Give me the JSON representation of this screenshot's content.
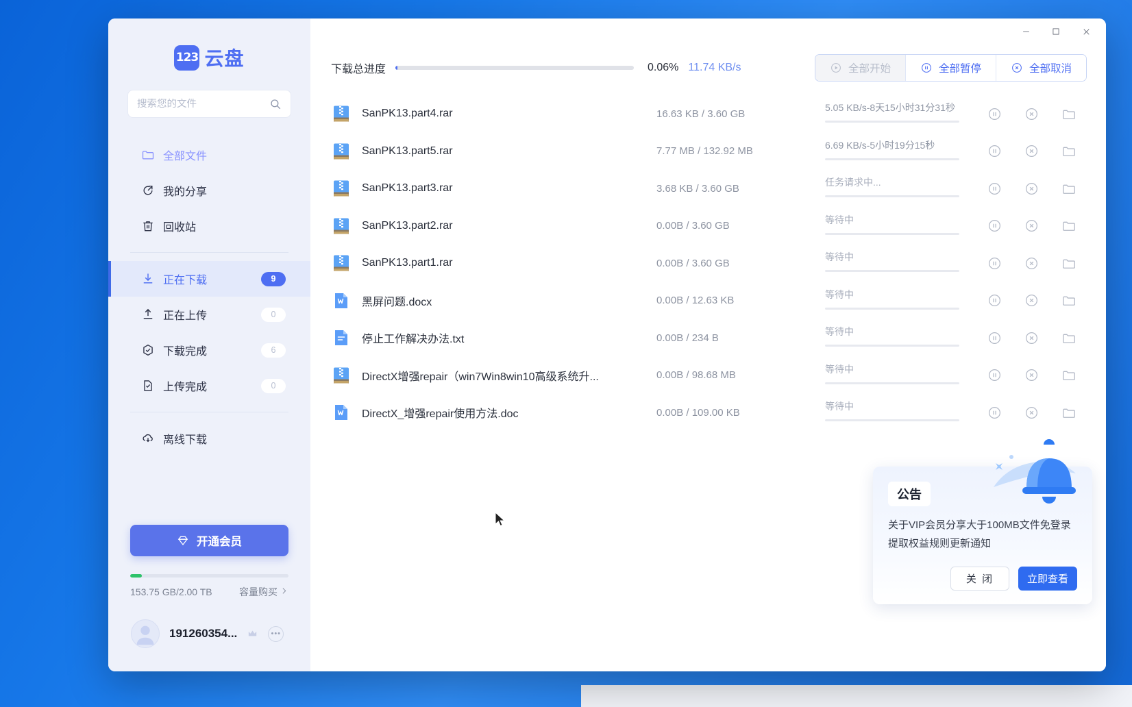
{
  "brand": {
    "logo_mark": "123",
    "logo_text": "云盘",
    "logo_icon": "cloud-disk-logo"
  },
  "search": {
    "placeholder": "搜索您的文件",
    "value": "",
    "icon": "search-icon"
  },
  "sidebar": {
    "primary_items": [
      {
        "label": "全部文件",
        "icon": "folder-icon",
        "state": "tinted"
      },
      {
        "label": "我的分享",
        "icon": "share-icon",
        "state": "normal"
      },
      {
        "label": "回收站",
        "icon": "trash-icon",
        "state": "normal"
      }
    ],
    "transfer_items": [
      {
        "label": "正在下载",
        "icon": "download-icon",
        "badge": "9",
        "state": "active"
      },
      {
        "label": "正在上传",
        "icon": "upload-icon",
        "badge": "0",
        "state": "normal"
      },
      {
        "label": "下载完成",
        "icon": "check-circle-icon",
        "badge": "6",
        "state": "normal"
      },
      {
        "label": "上传完成",
        "icon": "file-check-icon",
        "badge": "0",
        "state": "normal"
      }
    ],
    "offline_items": [
      {
        "label": "离线下载",
        "icon": "cloud-download-icon",
        "state": "normal"
      }
    ],
    "vip_button": {
      "label": "开通会员",
      "icon": "diamond-icon"
    },
    "storage": {
      "used_label": "153.75 GB/2.00 TB",
      "buy_label": "容量购买",
      "percent": 7.5,
      "fill_color": "#2ec36b"
    },
    "user": {
      "name": "191260354...",
      "avatar_icon": "user-avatar",
      "vip_icon": "vip-crown-icon",
      "more_icon": "more-horizontal-icon"
    }
  },
  "titlebar": {
    "minimize": "—",
    "maximize": "□",
    "close": "✕"
  },
  "toolbar": {
    "progress_label": "下载总进度",
    "progress_percent_value": 0.06,
    "progress_percent_text": "0.06%",
    "speed": "11.74 KB/s",
    "actions": [
      {
        "label": "全部开始",
        "icon": "play-circle-icon",
        "disabled": true
      },
      {
        "label": "全部暂停",
        "icon": "pause-circle-icon",
        "disabled": false
      },
      {
        "label": "全部取消",
        "icon": "close-circle-icon",
        "disabled": false
      }
    ]
  },
  "rows": [
    {
      "name": "SanPK13.part4.rar",
      "icon": "rar-file-icon",
      "size": "16.63 KB / 3.60 GB",
      "status": "5.05 KB/s-8天15小时31分31秒",
      "status_kind": "active",
      "progress": 0
    },
    {
      "name": "SanPK13.part5.rar",
      "icon": "rar-file-icon",
      "size": "7.77 MB / 132.92 MB",
      "status": "6.69 KB/s-5小时19分15秒",
      "status_kind": "active",
      "progress": 5.8
    },
    {
      "name": "SanPK13.part3.rar",
      "icon": "rar-file-icon",
      "size": "3.68 KB / 3.60 GB",
      "status": "任务请求中...",
      "status_kind": "pending",
      "progress": 0
    },
    {
      "name": "SanPK13.part2.rar",
      "icon": "rar-file-icon",
      "size": "0.00B / 3.60 GB",
      "status": "等待中",
      "status_kind": "waiting",
      "progress": 0
    },
    {
      "name": "SanPK13.part1.rar",
      "icon": "rar-file-icon",
      "size": "0.00B / 3.60 GB",
      "status": "等待中",
      "status_kind": "waiting",
      "progress": 0
    },
    {
      "name": "黑屏问题.docx",
      "icon": "word-file-icon",
      "size": "0.00B / 12.63 KB",
      "status": "等待中",
      "status_kind": "waiting",
      "progress": 0
    },
    {
      "name": "停止工作解决办法.txt",
      "icon": "txt-file-icon",
      "size": "0.00B / 234 B",
      "status": "等待中",
      "status_kind": "waiting",
      "progress": 0
    },
    {
      "name": "DirectX增强repair（win7Win8win10高级系统升...",
      "icon": "rar-file-icon",
      "size": "0.00B / 98.68 MB",
      "status": "等待中",
      "status_kind": "waiting",
      "progress": 0
    },
    {
      "name": "DirectX_增强repair使用方法.doc",
      "icon": "word-file-icon",
      "size": "0.00B / 109.00 KB",
      "status": "等待中",
      "status_kind": "waiting",
      "progress": 0
    }
  ],
  "row_actions": {
    "pause": {
      "label": "暂停",
      "icon": "pause-circle-icon"
    },
    "cancel": {
      "label": "取消",
      "icon": "close-circle-icon"
    },
    "open_folder": {
      "label": "打开文件夹",
      "icon": "folder-open-icon"
    }
  },
  "announcement": {
    "tag": "公告",
    "icon": "bell-icon",
    "body": "关于VIP会员分享大于100MB文件免登录提取权益规则更新通知",
    "close_label": "关 闭",
    "view_label": "立即查看"
  },
  "colors": {
    "accent": "#4e6ef2",
    "accent_dark": "#2b54e0",
    "sidebar_bg": "#eef1fa",
    "desktop": "#1677e8",
    "storage_green": "#2ec36b"
  }
}
